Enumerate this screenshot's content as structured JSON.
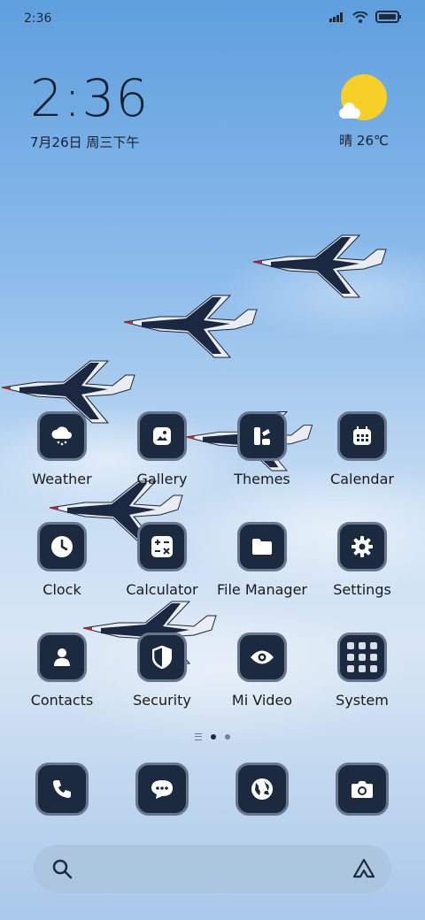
{
  "status_bar": {
    "time": "2:36"
  },
  "clock_widget": {
    "time": "2:36",
    "date": "7月26日 周三下午"
  },
  "weather_widget": {
    "temp": "晴 26℃"
  },
  "apps": [
    {
      "label": "Weather",
      "icon": "weather-icon"
    },
    {
      "label": "Gallery",
      "icon": "gallery-icon"
    },
    {
      "label": "Themes",
      "icon": "themes-icon"
    },
    {
      "label": "Calendar",
      "icon": "calendar-icon"
    },
    {
      "label": "Clock",
      "icon": "clock-icon"
    },
    {
      "label": "Calculator",
      "icon": "calculator-icon"
    },
    {
      "label": "File Manager",
      "icon": "folder-icon"
    },
    {
      "label": "Settings",
      "icon": "gear-icon"
    },
    {
      "label": "Contacts",
      "icon": "person-icon"
    },
    {
      "label": "Security",
      "icon": "shield-icon"
    },
    {
      "label": "Mi Video",
      "icon": "eye-icon"
    },
    {
      "label": "System",
      "icon": "folder-grid-icon"
    }
  ],
  "dock": [
    {
      "icon": "phone-icon"
    },
    {
      "icon": "message-icon"
    },
    {
      "icon": "globe-icon"
    },
    {
      "icon": "camera-icon"
    }
  ],
  "pager": {
    "page_count": 2,
    "active_page": 1
  },
  "colors": {
    "tile_bg": "#1c2a3f",
    "tile_border": "#67768c",
    "sun": "#f6cf29"
  }
}
